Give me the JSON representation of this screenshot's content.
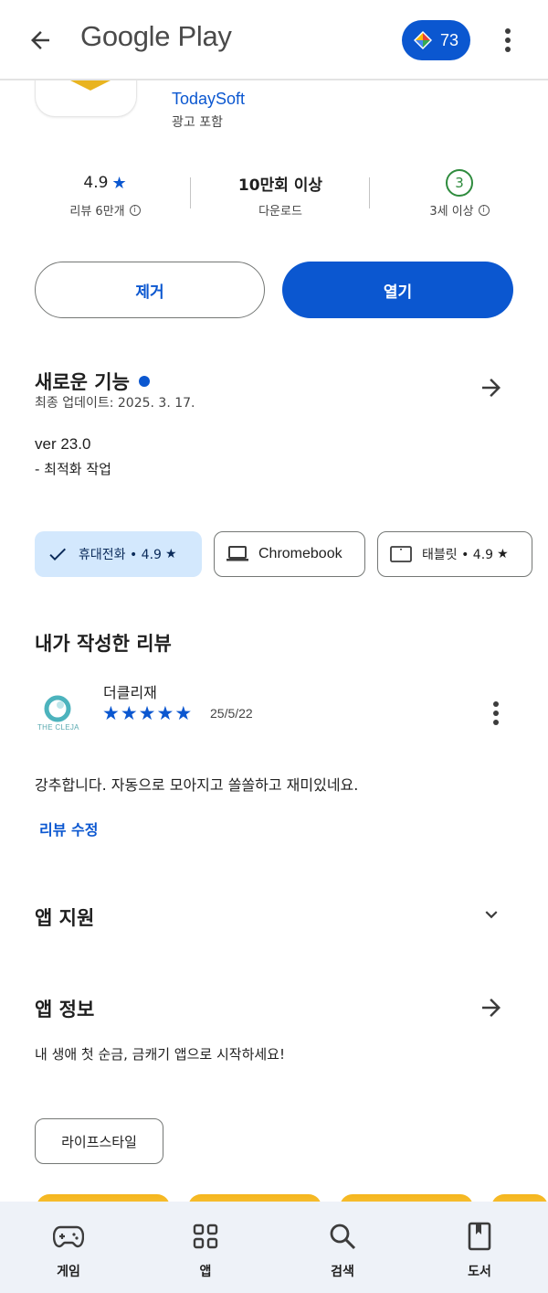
{
  "topbar": {
    "title": "Google Play",
    "points": "73"
  },
  "app": {
    "developer": "TodaySoft",
    "ads": "광고 포함"
  },
  "stats": {
    "rating": "4.9",
    "reviews": "리뷰 6만개",
    "downloads": "10만회 이상",
    "downloads_label": "다운로드",
    "age_rating": "3",
    "age_label": "3세 이상"
  },
  "actions": {
    "remove": "제거",
    "open": "열기"
  },
  "whats_new": {
    "title": "새로운 기능",
    "updated": "최종 업데이트: 2025. 3. 17.",
    "version": "ver 23.0",
    "notes": "- 최적화 작업"
  },
  "devices": [
    {
      "label": "휴대전화 • 4.9",
      "icon": "check-icon",
      "star": "★"
    },
    {
      "label": "Chromebook",
      "icon": "laptop-icon"
    },
    {
      "label": "태블릿 • 4.9",
      "icon": "tablet-icon",
      "star": "★"
    }
  ],
  "my_review": {
    "title": "내가 작성한 리뷰",
    "avatar_caption": "THE CLEJA",
    "reviewer": "더클리재",
    "stars": 5,
    "date": "25/5/22",
    "text": "강추합니다. 자동으로 모아지고 쏠쏠하고 재미있네요.",
    "edit": "리뷰 수정"
  },
  "app_support": {
    "title": "앱 지원"
  },
  "about": {
    "title": "앱 정보",
    "description": "내 생애 첫 순금, 금캐기 앱으로 시작하세요!",
    "tag": "라이프스타일"
  },
  "bottom_nav": [
    {
      "label": "게임",
      "icon": "gamepad-icon"
    },
    {
      "label": "앱",
      "icon": "apps-grid-icon"
    },
    {
      "label": "검색",
      "icon": "search-icon"
    },
    {
      "label": "도서",
      "icon": "book-icon"
    }
  ],
  "colors": {
    "accent": "#0b57d0",
    "age_green": "#2e8b3d",
    "chip_selected": "#d3e8fd",
    "nav_bg": "#eef2f8"
  }
}
